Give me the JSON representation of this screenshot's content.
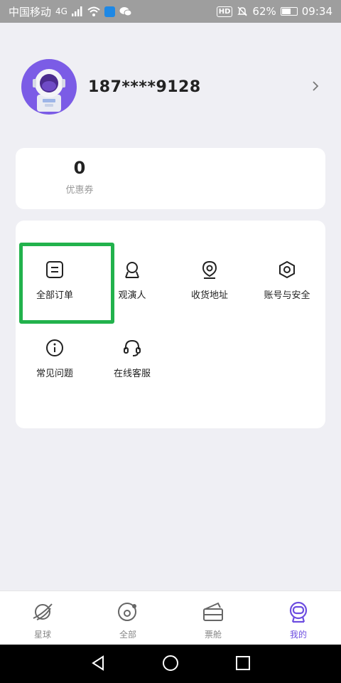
{
  "status_bar": {
    "carrier": "中国移动",
    "network": "4G",
    "battery": "62%",
    "battery_level": 0.62,
    "time": "09:34",
    "hd_badge": "HD"
  },
  "profile": {
    "phone": "187****9128"
  },
  "coupon": {
    "value": "0",
    "label": "优惠券"
  },
  "menu": {
    "items": [
      {
        "label": "全部订单",
        "icon": "order-icon"
      },
      {
        "label": "观演人",
        "icon": "person-icon"
      },
      {
        "label": "收货地址",
        "icon": "location-icon"
      },
      {
        "label": "账号与安全",
        "icon": "hexagon-icon"
      },
      {
        "label": "常见问题",
        "icon": "info-icon"
      },
      {
        "label": "在线客服",
        "icon": "headset-icon"
      }
    ]
  },
  "tabbar": {
    "tabs": [
      {
        "label": "星球",
        "icon": "planet-icon"
      },
      {
        "label": "全部",
        "icon": "all-icon"
      },
      {
        "label": "票舱",
        "icon": "ticket-icon"
      },
      {
        "label": "我的",
        "icon": "astronaut-icon"
      }
    ],
    "active_index": 3,
    "active_color": "#6c4de0"
  },
  "colors": {
    "accent": "#6c4de0",
    "highlight_box": "#22b24c"
  }
}
